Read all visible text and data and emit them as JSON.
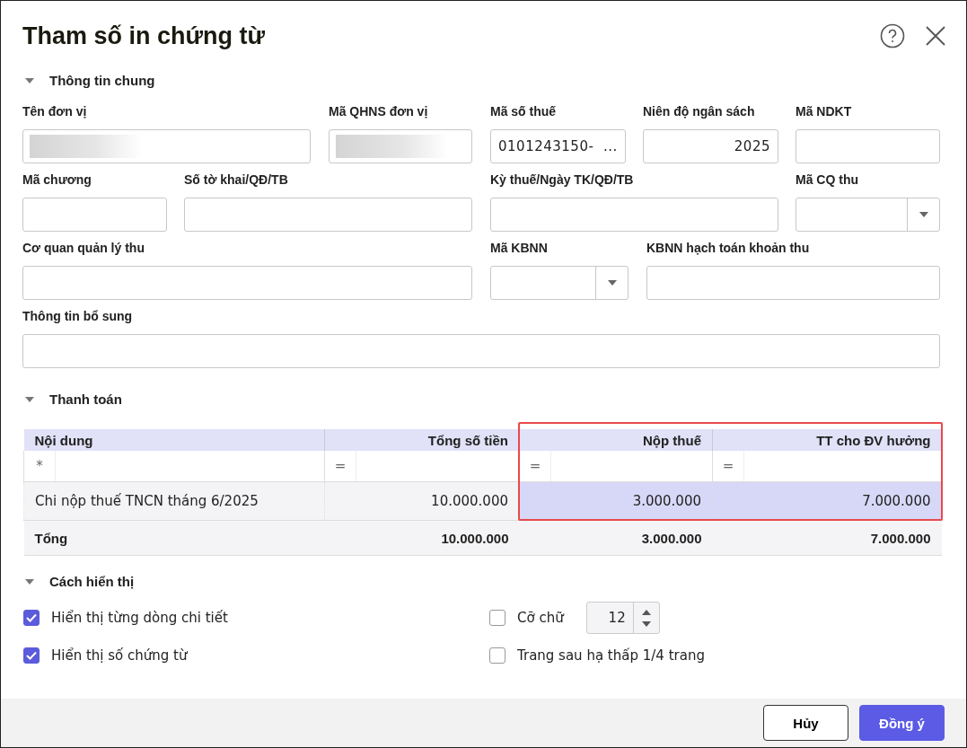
{
  "window": {
    "title": "Tham số in chứng từ"
  },
  "general": {
    "title": "Thông tin chung",
    "expanded": true,
    "fields": [
      {
        "label": "Tên đơn vị",
        "kind": "redacted"
      },
      {
        "label": "Mã QHNS đơn vị",
        "kind": "redacted"
      },
      {
        "label": "Mã số thuế",
        "kind": "text",
        "value": "0101243150-  ..."
      },
      {
        "label": "Niên độ ngân sách",
        "kind": "number",
        "value": "2025"
      },
      {
        "label": "Mã NDKT",
        "kind": "text"
      },
      {
        "label": "Mã chương",
        "kind": "text"
      },
      {
        "label": "Số tờ khai/QĐ/TB",
        "kind": "text"
      },
      {
        "label": "Kỳ thuế/Ngày TK/QĐ/TB",
        "kind": "text"
      },
      {
        "label": "Mã CQ thu",
        "kind": "select"
      },
      {
        "label": "Cơ quan quản lý thu",
        "kind": "text"
      },
      {
        "label": "Mã KBNN",
        "kind": "select"
      },
      {
        "label": "KBNN hạch toán khoản thu",
        "kind": "text"
      },
      {
        "label": "Thông tin bổ sung",
        "kind": "text"
      }
    ]
  },
  "payment": {
    "title": "Thanh toán",
    "expanded": true,
    "columns": [
      {
        "label": "Nội dung",
        "filter": "*",
        "selected": false
      },
      {
        "label": "Tổng số tiền",
        "filter": "=",
        "selected": false
      },
      {
        "label": "Nộp thuế",
        "filter": "=",
        "selected": true
      },
      {
        "label": "TT cho ĐV hưởng",
        "filter": "=",
        "selected": true
      }
    ],
    "rows": [
      [
        "Chi nộp thuế TNCN tháng 6/2025",
        "10.000.000",
        "3.000.000",
        "7.000.000"
      ]
    ],
    "total": [
      "Tổng",
      "10.000.000",
      "3.000.000",
      "7.000.000"
    ]
  },
  "display": {
    "title": "Cách hiển thị",
    "expanded": true,
    "options": [
      {
        "label": "Hiển thị từng dòng chi tiết",
        "checked": true
      },
      {
        "label": "Cỡ chữ",
        "checked": false,
        "spin_value": "12"
      },
      {
        "label": "Hiển thị số chứng từ",
        "checked": true
      },
      {
        "label": "Trang sau hạ thấp 1/4 trang",
        "checked": false
      }
    ]
  },
  "buttons": [
    {
      "label": "Hủy",
      "kind": "secondary"
    },
    {
      "label": "Đồng ý",
      "kind": "primary"
    }
  ]
}
